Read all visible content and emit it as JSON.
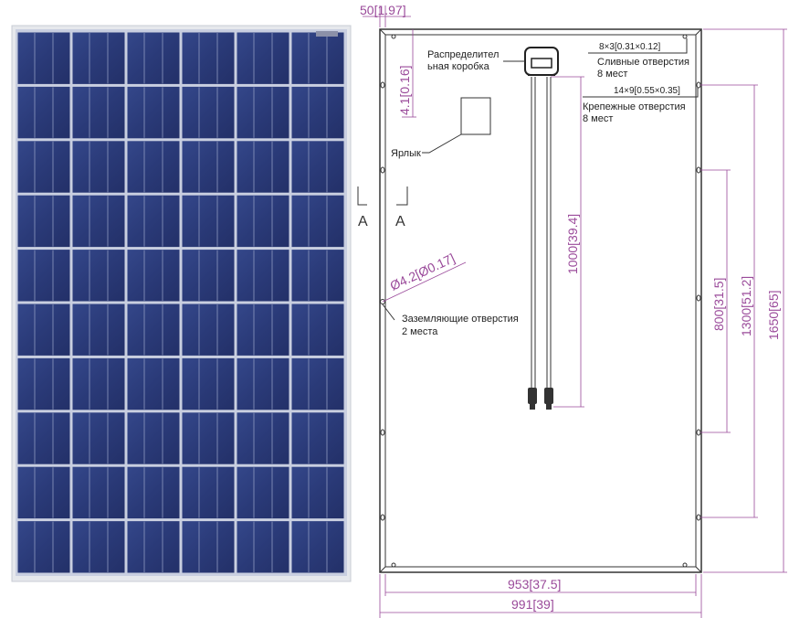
{
  "photo": {
    "description_icon": "solar-panel-photo",
    "cell_rows": 10,
    "cell_cols": 6,
    "frame_color": "#e6e8ec",
    "cell_color": "#2d3c78",
    "grid_color": "#c9cfe0"
  },
  "drawing": {
    "labels": {
      "junction_box": [
        "Распределител",
        "ьная коробка"
      ],
      "drain_holes": [
        "8×3[0.31×0.12]",
        "Сливные отверстия",
        "8 мест"
      ],
      "mount_holes": [
        "14×9[0.55×0.35]",
        "Крепежные отверстия",
        "8 мест"
      ],
      "label_tag": "Ярлык",
      "ground_holes": [
        "Заземляющие отверстия",
        "2 места"
      ],
      "section_left": "A",
      "section_right": "A"
    },
    "dimensions": {
      "frame_width_top": "50[1.97]",
      "edge_offset": "4.1[0.16]",
      "ground_diameter": "Ø4.2[Ø0.17]",
      "cable_length": "1000[39.4]",
      "mount_800": "800[31.5]",
      "mount_1300": "1300[51.2]",
      "height_total": "1650[65]",
      "inner_width": "953[37.5]",
      "total_width": "991[39]"
    },
    "colors": {
      "dimension": "#9a4a9a",
      "outline": "#333333"
    }
  }
}
